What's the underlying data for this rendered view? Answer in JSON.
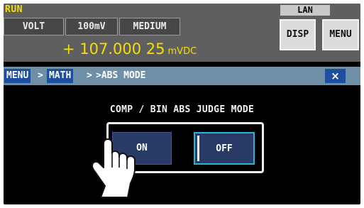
{
  "status": {
    "run": "RUN",
    "lan": "LAN"
  },
  "measurement": {
    "function": "VOLT",
    "range": "100mV",
    "speed": "MEDIUM",
    "value": "+ 107.000 25",
    "unit": "mVDC"
  },
  "header_buttons": {
    "disp": "DISP",
    "menu": "MENU"
  },
  "breadcrumb": {
    "items": [
      "MENU",
      "MATH"
    ],
    "separator": ">",
    "current": ">ABS MODE",
    "close": "×"
  },
  "dialog": {
    "title": "COMP / BIN ABS JUDGE MODE",
    "options": [
      "ON",
      "OFF"
    ],
    "selected": "OFF"
  },
  "icons": {
    "touch": "pointing-hand-icon",
    "close": "close-icon"
  },
  "colors": {
    "accent_yellow": "#f7df00",
    "button_blue": "#283a66",
    "selection_cyan": "#2db3d6",
    "breadcrumb_bar": "#6f8fa6"
  }
}
